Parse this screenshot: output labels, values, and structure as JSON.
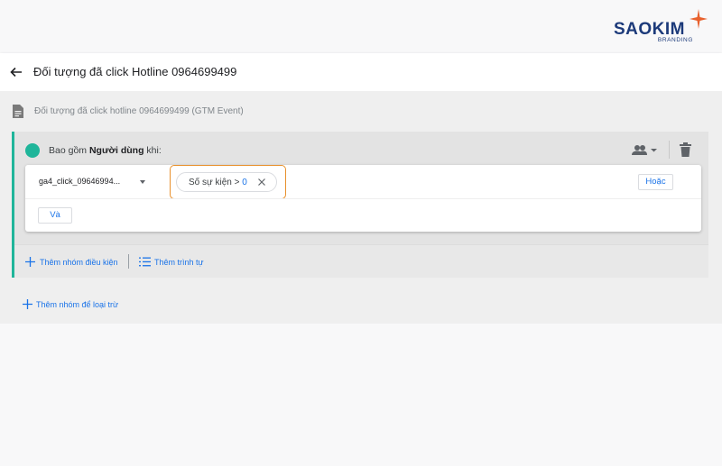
{
  "logo": {
    "text": "SAOKIM",
    "sub": "BRANDING"
  },
  "header": {
    "back_icon": "arrow-left-icon",
    "title": "Đối tượng đã click Hotline 0964699499"
  },
  "subtitle": {
    "icon": "document-icon",
    "text": "Đối tượng đã click hotline 0964699499 (GTM Event)"
  },
  "group": {
    "label_prefix": "Bao gồm ",
    "label_bold": "Người dùng",
    "label_suffix": " khi:",
    "scope_icon": "people-icon",
    "delete_icon": "trash-icon",
    "condition": {
      "event_name": "ga4_click_09646994...",
      "chip_label": "Số sự kiện > ",
      "chip_value": "0",
      "or_label": "Hoặc",
      "and_label": "Và"
    },
    "footer": {
      "add_condition_group": "Thêm nhóm điều kiện",
      "add_sequence": "Thêm trình tự"
    }
  },
  "add_exclude_group": "Thêm nhóm để loại trừ",
  "colors": {
    "accent": "#1fb59a",
    "link": "#1a73e8",
    "highlight": "#e8912d",
    "brand": "#1c3a7a"
  }
}
